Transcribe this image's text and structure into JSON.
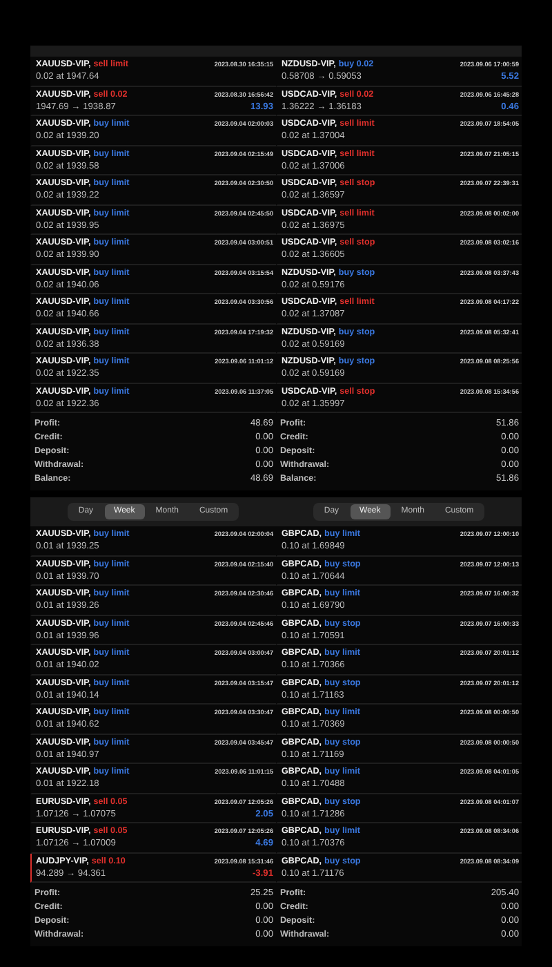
{
  "panels": [
    {
      "rows": [
        {
          "symbol": "XAUUSD-VIP,",
          "kind": "sell",
          "action": "sell limit",
          "time": "2023.08.30 16:35:15",
          "detail": "0.02 at 1947.64"
        },
        {
          "symbol": "XAUUSD-VIP,",
          "kind": "sell",
          "action": "sell 0.02",
          "time": "2023.08.30 16:56:42",
          "detail": "1947.69 → 1938.87",
          "profit": "13.93"
        },
        {
          "symbol": "XAUUSD-VIP,",
          "kind": "buy",
          "action": "buy limit",
          "time": "2023.09.04 02:00:03",
          "detail": "0.02 at 1939.20"
        },
        {
          "symbol": "XAUUSD-VIP,",
          "kind": "buy",
          "action": "buy limit",
          "time": "2023.09.04 02:15:49",
          "detail": "0.02 at 1939.58"
        },
        {
          "symbol": "XAUUSD-VIP,",
          "kind": "buy",
          "action": "buy limit",
          "time": "2023.09.04 02:30:50",
          "detail": "0.02 at 1939.22"
        },
        {
          "symbol": "XAUUSD-VIP,",
          "kind": "buy",
          "action": "buy limit",
          "time": "2023.09.04 02:45:50",
          "detail": "0.02 at 1939.95"
        },
        {
          "symbol": "XAUUSD-VIP,",
          "kind": "buy",
          "action": "buy limit",
          "time": "2023.09.04 03:00:51",
          "detail": "0.02 at 1939.90"
        },
        {
          "symbol": "XAUUSD-VIP,",
          "kind": "buy",
          "action": "buy limit",
          "time": "2023.09.04 03:15:54",
          "detail": "0.02 at 1940.06"
        },
        {
          "symbol": "XAUUSD-VIP,",
          "kind": "buy",
          "action": "buy limit",
          "time": "2023.09.04 03:30:56",
          "detail": "0.02 at 1940.66"
        },
        {
          "symbol": "XAUUSD-VIP,",
          "kind": "buy",
          "action": "buy limit",
          "time": "2023.09.04 17:19:32",
          "detail": "0.02 at 1936.38"
        },
        {
          "symbol": "XAUUSD-VIP,",
          "kind": "buy",
          "action": "buy limit",
          "time": "2023.09.06 11:01:12",
          "detail": "0.02 at 1922.35"
        },
        {
          "symbol": "XAUUSD-VIP,",
          "kind": "buy",
          "action": "buy limit",
          "time": "2023.09.06 11:37:05",
          "detail": "0.02 at 1922.36"
        }
      ],
      "summary": [
        {
          "label": "Profit:",
          "value": "48.69"
        },
        {
          "label": "Credit:",
          "value": "0.00"
        },
        {
          "label": "Deposit:",
          "value": "0.00"
        },
        {
          "label": "Withdrawal:",
          "value": "0.00"
        },
        {
          "label": "Balance:",
          "value": "48.69"
        }
      ]
    },
    {
      "rows": [
        {
          "symbol": "NZDUSD-VIP,",
          "kind": "buy",
          "action": "buy 0.02",
          "time": "2023.09.06 17:00:59",
          "detail": "0.58708 → 0.59053",
          "profit": "5.52"
        },
        {
          "symbol": "USDCAD-VIP,",
          "kind": "sell",
          "action": "sell 0.02",
          "time": "2023.09.06 16:45:28",
          "detail": "1.36222 → 1.36183",
          "profit": "0.46"
        },
        {
          "symbol": "USDCAD-VIP,",
          "kind": "sell",
          "action": "sell limit",
          "time": "2023.09.07 18:54:05",
          "detail": "0.02 at 1.37004"
        },
        {
          "symbol": "USDCAD-VIP,",
          "kind": "sell",
          "action": "sell limit",
          "time": "2023.09.07 21:05:15",
          "detail": "0.02 at 1.37006"
        },
        {
          "symbol": "USDCAD-VIP,",
          "kind": "sell",
          "action": "sell stop",
          "time": "2023.09.07 22:39:31",
          "detail": "0.02 at 1.36597"
        },
        {
          "symbol": "USDCAD-VIP,",
          "kind": "sell",
          "action": "sell limit",
          "time": "2023.09.08 00:02:00",
          "detail": "0.02 at 1.36975"
        },
        {
          "symbol": "USDCAD-VIP,",
          "kind": "sell",
          "action": "sell stop",
          "time": "2023.09.08 03:02:16",
          "detail": "0.02 at 1.36605"
        },
        {
          "symbol": "NZDUSD-VIP,",
          "kind": "buy",
          "action": "buy stop",
          "time": "2023.09.08 03:37:43",
          "detail": "0.02 at 0.59176"
        },
        {
          "symbol": "USDCAD-VIP,",
          "kind": "sell",
          "action": "sell limit",
          "time": "2023.09.08 04:17:22",
          "detail": "0.02 at 1.37087"
        },
        {
          "symbol": "NZDUSD-VIP,",
          "kind": "buy",
          "action": "buy stop",
          "time": "2023.09.08 05:32:41",
          "detail": "0.02 at 0.59169"
        },
        {
          "symbol": "NZDUSD-VIP,",
          "kind": "buy",
          "action": "buy stop",
          "time": "2023.09.08 08:25:56",
          "detail": "0.02 at 0.59169"
        },
        {
          "symbol": "USDCAD-VIP,",
          "kind": "sell",
          "action": "sell stop",
          "time": "2023.09.08 15:34:56",
          "detail": "0.02 at 1.35997"
        }
      ],
      "summary": [
        {
          "label": "Profit:",
          "value": "51.86"
        },
        {
          "label": "Credit:",
          "value": "0.00"
        },
        {
          "label": "Deposit:",
          "value": "0.00"
        },
        {
          "label": "Withdrawal:",
          "value": "0.00"
        },
        {
          "label": "Balance:",
          "value": "51.86"
        }
      ]
    },
    {
      "tabs": [
        {
          "label": "Day",
          "selected": false
        },
        {
          "label": "Week",
          "selected": true
        },
        {
          "label": "Month",
          "selected": false
        },
        {
          "label": "Custom",
          "selected": false
        }
      ],
      "rows": [
        {
          "symbol": "XAUUSD-VIP,",
          "kind": "buy",
          "action": "buy limit",
          "time": "2023.09.04 02:00:04",
          "detail": "0.01 at 1939.25"
        },
        {
          "symbol": "XAUUSD-VIP,",
          "kind": "buy",
          "action": "buy limit",
          "time": "2023.09.04 02:15:40",
          "detail": "0.01 at 1939.70"
        },
        {
          "symbol": "XAUUSD-VIP,",
          "kind": "buy",
          "action": "buy limit",
          "time": "2023.09.04 02:30:46",
          "detail": "0.01 at 1939.26"
        },
        {
          "symbol": "XAUUSD-VIP,",
          "kind": "buy",
          "action": "buy limit",
          "time": "2023.09.04 02:45:46",
          "detail": "0.01 at 1939.96"
        },
        {
          "symbol": "XAUUSD-VIP,",
          "kind": "buy",
          "action": "buy limit",
          "time": "2023.09.04 03:00:47",
          "detail": "0.01 at 1940.02"
        },
        {
          "symbol": "XAUUSD-VIP,",
          "kind": "buy",
          "action": "buy limit",
          "time": "2023.09.04 03:15:47",
          "detail": "0.01 at 1940.14"
        },
        {
          "symbol": "XAUUSD-VIP,",
          "kind": "buy",
          "action": "buy limit",
          "time": "2023.09.04 03:30:47",
          "detail": "0.01 at 1940.62"
        },
        {
          "symbol": "XAUUSD-VIP,",
          "kind": "buy",
          "action": "buy limit",
          "time": "2023.09.04 03:45:47",
          "detail": "0.01 at 1940.97"
        },
        {
          "symbol": "XAUUSD-VIP,",
          "kind": "buy",
          "action": "buy limit",
          "time": "2023.09.06 11:01:15",
          "detail": "0.01 at 1922.18"
        },
        {
          "symbol": "EURUSD-VIP,",
          "kind": "sell",
          "action": "sell 0.05",
          "time": "2023.09.07 12:05:26",
          "detail": "1.07126 → 1.07075",
          "profit": "2.05"
        },
        {
          "symbol": "EURUSD-VIP,",
          "kind": "sell",
          "action": "sell 0.05",
          "time": "2023.09.07 12:05:26",
          "detail": "1.07126 → 1.07009",
          "profit": "4.69"
        },
        {
          "symbol": "AUDJPY-VIP,",
          "kind": "loss",
          "action": "sell 0.10",
          "time": "2023.09.08 15:31:46",
          "detail": "94.289 → 94.361",
          "profit": "-3.91"
        }
      ],
      "summary": [
        {
          "label": "Profit:",
          "value": "25.25"
        },
        {
          "label": "Credit:",
          "value": "0.00"
        },
        {
          "label": "Deposit:",
          "value": "0.00"
        },
        {
          "label": "Withdrawal:",
          "value": "0.00"
        }
      ]
    },
    {
      "tabs": [
        {
          "label": "Day",
          "selected": false
        },
        {
          "label": "Week",
          "selected": true
        },
        {
          "label": "Month",
          "selected": false
        },
        {
          "label": "Custom",
          "selected": false
        }
      ],
      "rows": [
        {
          "symbol": "GBPCAD,",
          "kind": "buy",
          "action": "buy limit",
          "time": "2023.09.07 12:00:10",
          "detail": "0.10 at 1.69849"
        },
        {
          "symbol": "GBPCAD,",
          "kind": "buy",
          "action": "buy stop",
          "time": "2023.09.07 12:00:13",
          "detail": "0.10 at 1.70644"
        },
        {
          "symbol": "GBPCAD,",
          "kind": "buy",
          "action": "buy limit",
          "time": "2023.09.07 16:00:32",
          "detail": "0.10 at 1.69790"
        },
        {
          "symbol": "GBPCAD,",
          "kind": "buy",
          "action": "buy stop",
          "time": "2023.09.07 16:00:33",
          "detail": "0.10 at 1.70591"
        },
        {
          "symbol": "GBPCAD,",
          "kind": "buy",
          "action": "buy limit",
          "time": "2023.09.07 20:01:12",
          "detail": "0.10 at 1.70366"
        },
        {
          "symbol": "GBPCAD,",
          "kind": "buy",
          "action": "buy stop",
          "time": "2023.09.07 20:01:12",
          "detail": "0.10 at 1.71163"
        },
        {
          "symbol": "GBPCAD,",
          "kind": "buy",
          "action": "buy limit",
          "time": "2023.09.08 00:00:50",
          "detail": "0.10 at 1.70369"
        },
        {
          "symbol": "GBPCAD,",
          "kind": "buy",
          "action": "buy stop",
          "time": "2023.09.08 00:00:50",
          "detail": "0.10 at 1.71169"
        },
        {
          "symbol": "GBPCAD,",
          "kind": "buy",
          "action": "buy limit",
          "time": "2023.09.08 04:01:05",
          "detail": "0.10 at 1.70488"
        },
        {
          "symbol": "GBPCAD,",
          "kind": "buy",
          "action": "buy stop",
          "time": "2023.09.08 04:01:07",
          "detail": "0.10 at 1.71286"
        },
        {
          "symbol": "GBPCAD,",
          "kind": "buy",
          "action": "buy limit",
          "time": "2023.09.08 08:34:06",
          "detail": "0.10 at 1.70376"
        },
        {
          "symbol": "GBPCAD,",
          "kind": "buy",
          "action": "buy stop",
          "time": "2023.09.08 08:34:09",
          "detail": "0.10 at 1.71176"
        }
      ],
      "summary": [
        {
          "label": "Profit:",
          "value": "205.40"
        },
        {
          "label": "Credit:",
          "value": "0.00"
        },
        {
          "label": "Deposit:",
          "value": "0.00"
        },
        {
          "label": "Withdrawal:",
          "value": "0.00"
        }
      ]
    }
  ]
}
